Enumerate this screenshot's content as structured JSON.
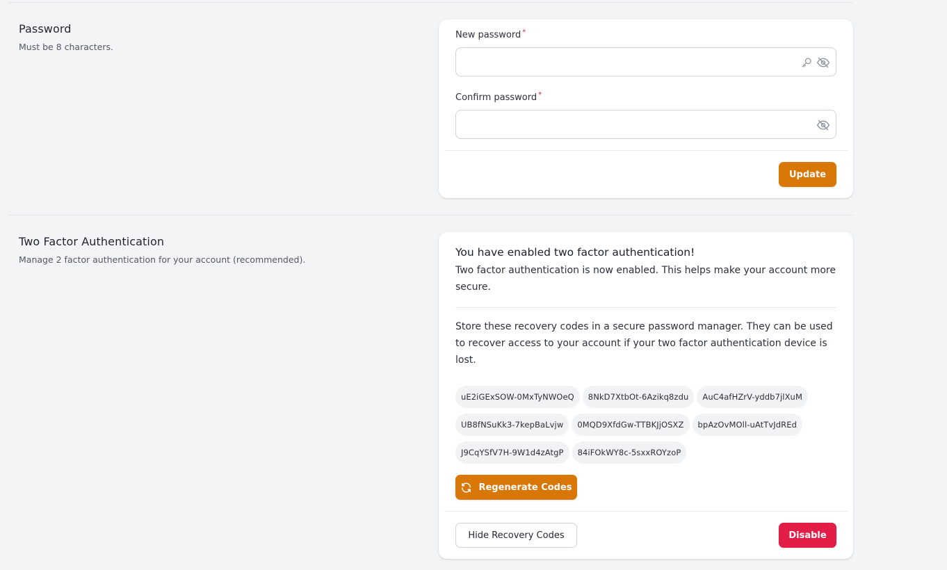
{
  "password_section": {
    "title": "Password",
    "description": "Must be 8 characters.",
    "new_password": {
      "label": "New password",
      "required_mark": "*",
      "value": "",
      "placeholder": "",
      "icons": [
        "key-icon",
        "eye-off-icon"
      ]
    },
    "confirm_password": {
      "label": "Confirm password",
      "required_mark": "*",
      "value": "",
      "placeholder": "",
      "icons": [
        "eye-off-icon"
      ]
    },
    "update_button": "Update"
  },
  "two_factor_section": {
    "title": "Two Factor Authentication",
    "description": "Manage 2 factor authentication for your account (recommended).",
    "status_heading": "You have enabled two factor authentication!",
    "status_text": "Two factor authentication is now enabled. This helps make your account more secure.",
    "recovery_text": "Store these recovery codes in a secure password manager. They can be used to recover access to your account if your two factor authentication device is lost.",
    "recovery_codes": [
      "uE2iGExSOW-0MxTyNWOeQ",
      "8NkD7XtbOt-6Azikq8zdu",
      "AuC4afHZrV-yddb7jlXuM",
      "UB8fNSuKk3-7kepBaLvjw",
      "0MQD9XfdGw-TTBKJjOSXZ",
      "bpAzOvMOll-uAtTvJdREd",
      "J9CqYSfV7H-9W1d4zAtgP",
      "84iFOkWY8c-5sxxROYzoP"
    ],
    "regenerate_button": "Regenerate Codes",
    "regenerate_icon": "refresh-icon",
    "hide_codes_button": "Hide Recovery Codes",
    "disable_button": "Disable"
  },
  "colors": {
    "page_background": "#f3f4f6",
    "primary": "#d97706",
    "danger": "#e11d48",
    "required": "#e11d48",
    "chip_background": "#f1f2f4"
  }
}
